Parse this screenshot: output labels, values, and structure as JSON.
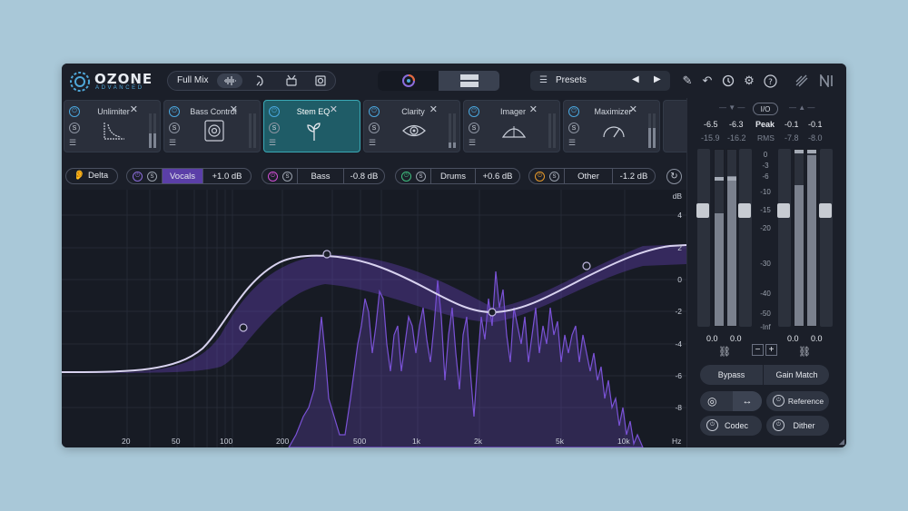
{
  "app": {
    "logo": "OZONE",
    "logo_sub": "ADVANCED"
  },
  "topbar": {
    "mix_label": "Full Mix",
    "presets_label": "Presets",
    "tools": [
      "pencil-icon",
      "undo-icon",
      "history-icon",
      "gear-icon",
      "help-icon",
      "ni-logo-icon"
    ]
  },
  "modules": [
    {
      "name": "Unlimiter",
      "icon": "curve-icon"
    },
    {
      "name": "Bass Control",
      "icon": "speaker-icon"
    },
    {
      "name": "Stem EQ",
      "icon": "sprout-icon",
      "active": true
    },
    {
      "name": "Clarity",
      "icon": "eye-icon"
    },
    {
      "name": "Imager",
      "icon": "fan-icon"
    },
    {
      "name": "Maximizer",
      "icon": "gauge-icon"
    }
  ],
  "bands": {
    "delta": "Delta",
    "items": [
      {
        "name": "Vocals",
        "value": "+1.0 dB",
        "color": "#8c6ddc",
        "active": true
      },
      {
        "name": "Bass",
        "value": "-0.8 dB",
        "color": "#d24fd6"
      },
      {
        "name": "Drums",
        "value": "+0.6 dB",
        "color": "#3fbf7f"
      },
      {
        "name": "Other",
        "value": "-1.2 dB",
        "color": "#e89a2a"
      }
    ]
  },
  "eq": {
    "db_unit": "dB",
    "db_ticks": [
      "4",
      "2",
      "0",
      "-2",
      "-4",
      "-6",
      "-8"
    ],
    "hz_ticks": [
      "20",
      "50",
      "100",
      "200",
      "500",
      "1k",
      "2k",
      "5k",
      "10k",
      "Hz"
    ]
  },
  "meters": {
    "io_label": "I/O",
    "in_peak": [
      "-6.5",
      "-6.3"
    ],
    "in_rms": [
      "-15.9",
      "-16.2"
    ],
    "out_peak": [
      "-0.1",
      "-0.1"
    ],
    "out_rms": [
      "-7.8",
      "-8.0"
    ],
    "peak_label": "Peak",
    "rms_label": "RMS",
    "scale": [
      "0",
      "-3",
      "-6",
      "-10",
      "-15",
      "-20",
      "-30",
      "-40",
      "-50",
      "-Inf"
    ],
    "in_gain": [
      "0.0",
      "0.0"
    ],
    "out_gain": [
      "0.0",
      "0.0"
    ],
    "minus": "−",
    "plus": "+",
    "in_level": [
      0.64,
      0.85
    ],
    "out_level": [
      0.8,
      0.97
    ]
  },
  "buttons": {
    "bypass": "Bypass",
    "gain_match": "Gain Match",
    "reference": "Reference",
    "codec": "Codec",
    "dither": "Dither"
  }
}
